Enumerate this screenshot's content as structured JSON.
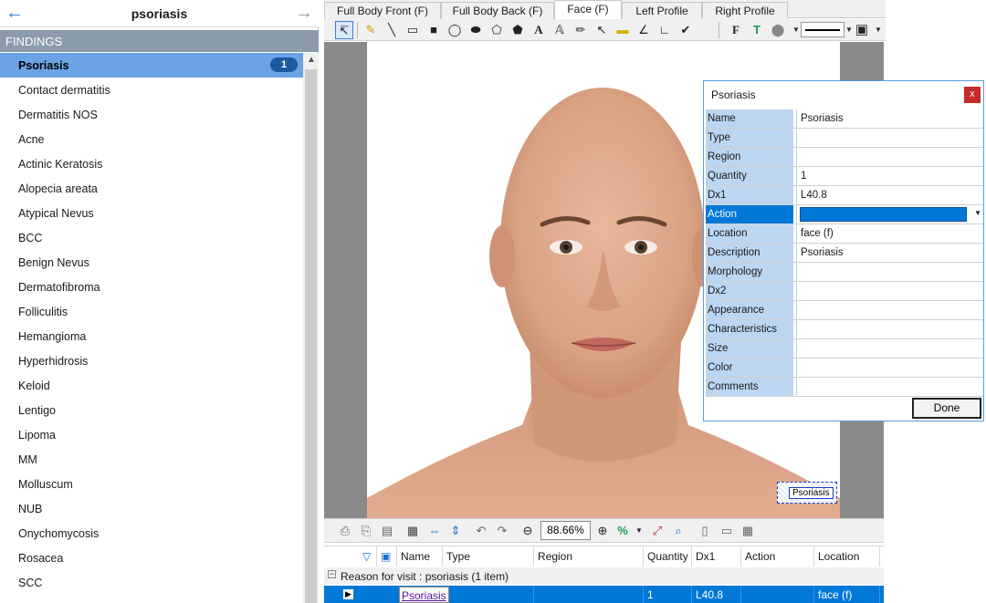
{
  "header": {
    "title": "psoriasis",
    "back_icon": "arrow-left-icon",
    "forward_icon": "arrow-right-icon"
  },
  "findings": {
    "label": "FINDINGS",
    "items": [
      {
        "label": "Psoriasis",
        "count": "1",
        "selected": true
      },
      {
        "label": "Contact dermatitis"
      },
      {
        "label": "Dermatitis NOS"
      },
      {
        "label": "Acne"
      },
      {
        "label": "Actinic Keratosis"
      },
      {
        "label": "Alopecia areata"
      },
      {
        "label": "Atypical Nevus"
      },
      {
        "label": "BCC"
      },
      {
        "label": "Benign Nevus"
      },
      {
        "label": "Dermatofibroma"
      },
      {
        "label": "Folliculitis"
      },
      {
        "label": "Hemangioma"
      },
      {
        "label": "Hyperhidrosis"
      },
      {
        "label": "Keloid"
      },
      {
        "label": "Lentigo"
      },
      {
        "label": "Lipoma"
      },
      {
        "label": "MM"
      },
      {
        "label": "Molluscum"
      },
      {
        "label": "NUB"
      },
      {
        "label": "Onychomycosis"
      },
      {
        "label": "Rosacea"
      },
      {
        "label": "SCC"
      }
    ]
  },
  "tabs": [
    "Full Body Front (F)",
    "Full Body Back (F)",
    "Face (F)",
    "Left Profile",
    "Right Profile"
  ],
  "canvas": {
    "marker_label": "Psoriasis"
  },
  "zoom": "88.66%",
  "grid": {
    "columns": [
      "Name",
      "Type",
      "Region",
      "Quantity",
      "Dx1",
      "Action",
      "Location"
    ],
    "group_label": "Reason for visit : psoriasis (1 item)",
    "row": {
      "name": "Psoriasis",
      "type": "",
      "region": "",
      "quantity": "1",
      "dx1": "L40.8",
      "action": "",
      "location": "face (f)"
    }
  },
  "dialog": {
    "title": "Psoriasis",
    "close": "x",
    "done_label": "Done",
    "fields": [
      {
        "label": "Name",
        "value": "Psoriasis"
      },
      {
        "label": "Type",
        "value": ""
      },
      {
        "label": "Region",
        "value": ""
      },
      {
        "label": "Quantity",
        "value": "1"
      },
      {
        "label": "Dx1",
        "value": "L40.8"
      },
      {
        "label": "Action",
        "value": ""
      },
      {
        "label": "Location",
        "value": "face (f)"
      },
      {
        "label": "Description",
        "value": "Psoriasis"
      },
      {
        "label": "Morphology",
        "value": ""
      },
      {
        "label": "Dx2",
        "value": ""
      },
      {
        "label": "Appearance",
        "value": ""
      },
      {
        "label": "Characteristics",
        "value": ""
      },
      {
        "label": "Size",
        "value": ""
      },
      {
        "label": "Color",
        "value": ""
      },
      {
        "label": "Comments",
        "value": ""
      }
    ]
  }
}
